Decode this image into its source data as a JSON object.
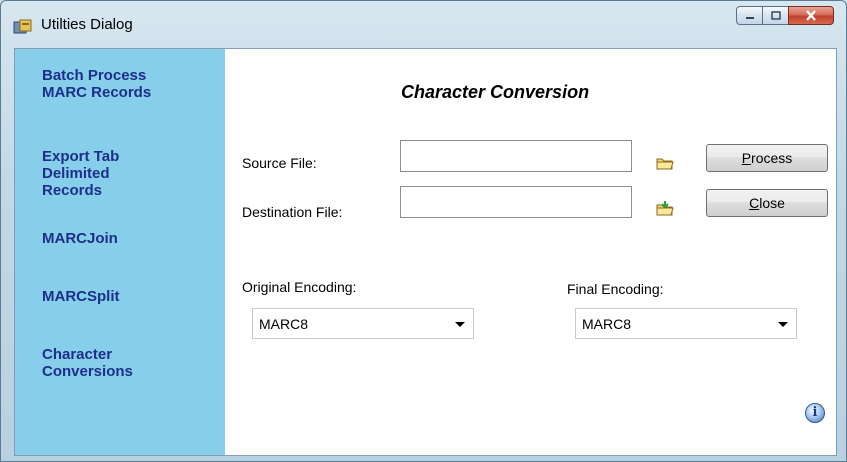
{
  "window": {
    "title": "Utilties Dialog",
    "icon": "app-icon",
    "controls": {
      "minimize": "minimize-icon",
      "maximize": "maximize-icon",
      "close": "close-icon"
    }
  },
  "sidebar": {
    "items": [
      {
        "label": "Batch Process\nMARC Records"
      },
      {
        "label": "Export Tab\nDelimited\nRecords"
      },
      {
        "label": "MARCJoin"
      },
      {
        "label": "MARCSplit"
      },
      {
        "label": "Character\nConversions"
      }
    ]
  },
  "main": {
    "title": "Character Conversion",
    "source_label": "Source File:",
    "source_value": "",
    "destination_label": "Destination File:",
    "destination_value": "",
    "process_button": {
      "accel": "P",
      "rest": "rocess"
    },
    "close_button": {
      "accel": "C",
      "rest": "lose"
    },
    "original_encoding_label": "Original Encoding:",
    "original_encoding_value": "MARC8",
    "final_encoding_label": "Final Encoding:",
    "final_encoding_value": "MARC8",
    "info_glyph": "i"
  },
  "colors": {
    "sidebar_bg": "#87ceea",
    "nav_text": "#1c2f8a"
  }
}
